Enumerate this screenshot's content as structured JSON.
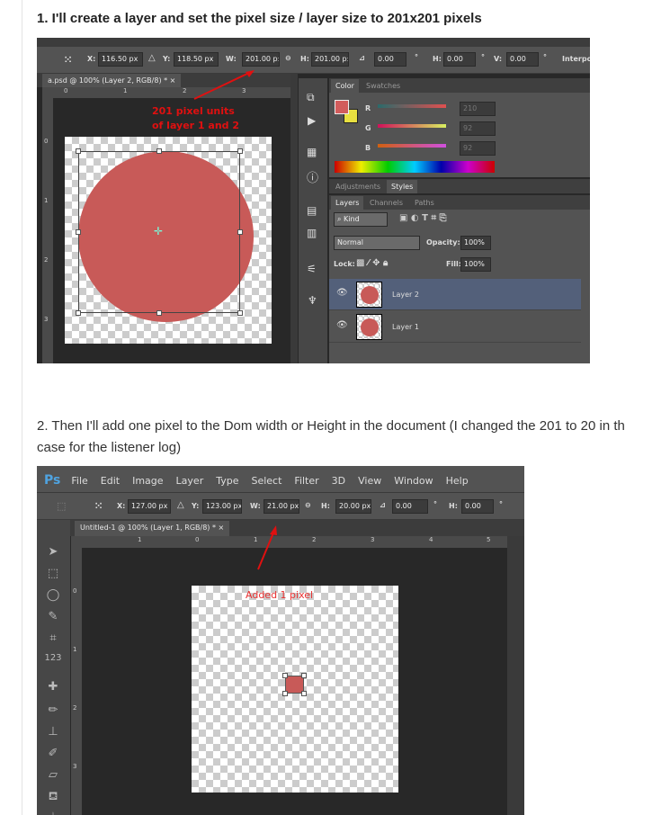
{
  "step1": {
    "text": "1. I'll create a layer and set the pixel size / layer size to 201x201 pixels"
  },
  "step2": {
    "line1": "2. Then I'll add one pixel to the Dom width or Height in the document (I changed the 201 to 20 in th",
    "line2": "case for the listener log)"
  },
  "shot1": {
    "options": {
      "x": "116.50 px",
      "y": "118.50 px",
      "w": "201.00 p:",
      "h": "201.00 p:",
      "angle": "0.00",
      "hskew": "0.00",
      "vskew": "0.00",
      "interp": "Interpo",
      "x_label": "X:",
      "y_label": "Y:",
      "w_label": "W:",
      "h_label": "H:",
      "hs_label": "H:",
      "vs_label": "V:",
      "deg": "°"
    },
    "doc_tab": "a.psd @ 100% (Layer 2, RGB/8) *",
    "close": "×",
    "ruler_h": [
      "0",
      "1",
      "2",
      "3"
    ],
    "ruler_v": [
      "0",
      "1",
      "2",
      "3"
    ],
    "annotation": [
      "201 pixel units",
      "of layer 1 and 2"
    ],
    "color_panel": {
      "tabs": [
        "Color",
        "Swatches"
      ],
      "channels": [
        {
          "label": "R",
          "value": "210"
        },
        {
          "label": "G",
          "value": "92"
        },
        {
          "label": "B",
          "value": "92"
        }
      ],
      "fg": "#d25c5c",
      "bg": "#e8e040"
    },
    "adj_tabs": [
      "Adjustments",
      "Styles"
    ],
    "layers_tabs": [
      "Layers",
      "Channels",
      "Paths"
    ],
    "kind": "Kind",
    "blend": "Normal",
    "opacity_label": "Opacity:",
    "opacity": "100%",
    "lock_label": "Lock:",
    "fill_label": "Fill:",
    "fill": "100%",
    "layers": [
      {
        "name": "Layer 2",
        "selected": true
      },
      {
        "name": "Layer 1",
        "selected": false
      }
    ]
  },
  "shot2": {
    "logo": "Ps",
    "menu": [
      "File",
      "Edit",
      "Image",
      "Layer",
      "Type",
      "Select",
      "Filter",
      "3D",
      "View",
      "Window",
      "Help"
    ],
    "options": {
      "x": "127.00 px",
      "y": "123.00 px",
      "w": "21.00 px",
      "h": "20.00 px",
      "angle": "0.00",
      "hskew": "0.00",
      "x_label": "X:",
      "y_label": "Y:",
      "w_label": "W:",
      "h_label": "H:",
      "hs_label": "H:",
      "deg": "°"
    },
    "doc_tab": "Untitled-1 @ 100% (Layer 1, RGB/8) *",
    "close": "×",
    "ruler_h": [
      "1",
      "0",
      "1",
      "2",
      "3",
      "4",
      "5"
    ],
    "ruler_v": [
      "0",
      "1",
      "2",
      "3"
    ],
    "annotation": "Added 1 pixel"
  },
  "colors": {
    "layer_fill": "#c85a58",
    "annotation": "#e01010",
    "selected_layer": "#53607a"
  }
}
